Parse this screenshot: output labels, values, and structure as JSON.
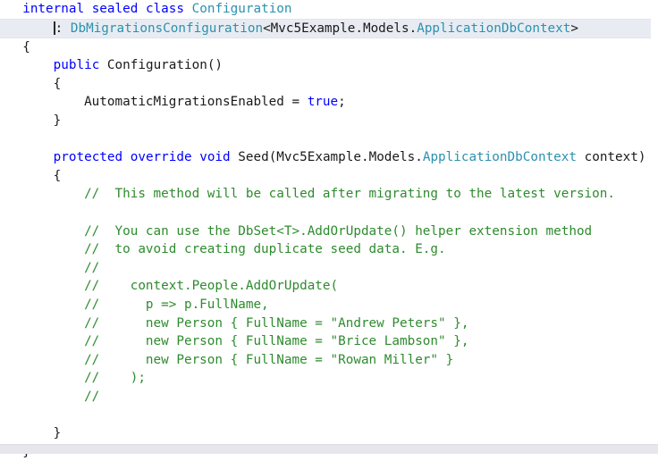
{
  "editor": {
    "language": "csharp",
    "colors": {
      "background": "#ffffff",
      "keyword": "#0000ff",
      "type": "#2b91af",
      "comment": "#2e8b2e",
      "plain": "#1a1a1a",
      "current_line_background": "#e8ecf2",
      "statusbar": "#e6e6ec"
    },
    "caret": {
      "line": 2,
      "column": 9
    },
    "lines": [
      {
        "n": 1,
        "current": false,
        "tokens": [
          {
            "t": "pln",
            "v": "  "
          },
          {
            "t": "kw",
            "v": "internal"
          },
          {
            "t": "pln",
            "v": " "
          },
          {
            "t": "kw",
            "v": "sealed"
          },
          {
            "t": "pln",
            "v": " "
          },
          {
            "t": "kw",
            "v": "class"
          },
          {
            "t": "pln",
            "v": " "
          },
          {
            "t": "type",
            "v": "Configuration"
          }
        ]
      },
      {
        "n": 2,
        "current": true,
        "caret_before": true,
        "tokens": [
          {
            "t": "pln",
            "v": "      "
          },
          {
            "t": "op",
            "v": ": "
          },
          {
            "t": "type",
            "v": "DbMigrationsConfiguration"
          },
          {
            "t": "op",
            "v": "<"
          },
          {
            "t": "pln",
            "v": "Mvc5Example.Models."
          },
          {
            "t": "type",
            "v": "ApplicationDbContext"
          },
          {
            "t": "op",
            "v": ">"
          }
        ]
      },
      {
        "n": 3,
        "current": false,
        "tokens": [
          {
            "t": "pln",
            "v": "  {"
          }
        ]
      },
      {
        "n": 4,
        "current": false,
        "tokens": [
          {
            "t": "pln",
            "v": "      "
          },
          {
            "t": "kw",
            "v": "public"
          },
          {
            "t": "pln",
            "v": " Configuration()"
          }
        ]
      },
      {
        "n": 5,
        "current": false,
        "tokens": [
          {
            "t": "pln",
            "v": "      {"
          }
        ]
      },
      {
        "n": 6,
        "current": false,
        "tokens": [
          {
            "t": "pln",
            "v": "          AutomaticMigrationsEnabled = "
          },
          {
            "t": "kw",
            "v": "true"
          },
          {
            "t": "pln",
            "v": ";"
          }
        ]
      },
      {
        "n": 7,
        "current": false,
        "tokens": [
          {
            "t": "pln",
            "v": "      }"
          }
        ]
      },
      {
        "n": 8,
        "current": false,
        "tokens": [
          {
            "t": "pln",
            "v": ""
          }
        ]
      },
      {
        "n": 9,
        "current": false,
        "tokens": [
          {
            "t": "pln",
            "v": "      "
          },
          {
            "t": "kw",
            "v": "protected"
          },
          {
            "t": "pln",
            "v": " "
          },
          {
            "t": "kw",
            "v": "override"
          },
          {
            "t": "pln",
            "v": " "
          },
          {
            "t": "kw",
            "v": "void"
          },
          {
            "t": "pln",
            "v": " Seed(Mvc5Example.Models."
          },
          {
            "t": "type",
            "v": "ApplicationDbContext"
          },
          {
            "t": "pln",
            "v": " context)"
          }
        ]
      },
      {
        "n": 10,
        "current": false,
        "tokens": [
          {
            "t": "pln",
            "v": "      {"
          }
        ]
      },
      {
        "n": 11,
        "current": false,
        "tokens": [
          {
            "t": "cmt",
            "v": "          //  This method will be called after migrating to the latest version."
          }
        ]
      },
      {
        "n": 12,
        "current": false,
        "tokens": [
          {
            "t": "pln",
            "v": ""
          }
        ]
      },
      {
        "n": 13,
        "current": false,
        "tokens": [
          {
            "t": "cmt",
            "v": "          //  You can use the DbSet<T>.AddOrUpdate() helper extension method"
          }
        ]
      },
      {
        "n": 14,
        "current": false,
        "tokens": [
          {
            "t": "cmt",
            "v": "          //  to avoid creating duplicate seed data. E.g."
          }
        ]
      },
      {
        "n": 15,
        "current": false,
        "tokens": [
          {
            "t": "cmt",
            "v": "          //"
          }
        ]
      },
      {
        "n": 16,
        "current": false,
        "tokens": [
          {
            "t": "cmt",
            "v": "          //    context.People.AddOrUpdate("
          }
        ]
      },
      {
        "n": 17,
        "current": false,
        "tokens": [
          {
            "t": "cmt",
            "v": "          //      p => p.FullName,"
          }
        ]
      },
      {
        "n": 18,
        "current": false,
        "tokens": [
          {
            "t": "cmt",
            "v": "          //      new Person { FullName = \"Andrew Peters\" },"
          }
        ]
      },
      {
        "n": 19,
        "current": false,
        "tokens": [
          {
            "t": "cmt",
            "v": "          //      new Person { FullName = \"Brice Lambson\" },"
          }
        ]
      },
      {
        "n": 20,
        "current": false,
        "tokens": [
          {
            "t": "cmt",
            "v": "          //      new Person { FullName = \"Rowan Miller\" }"
          }
        ]
      },
      {
        "n": 21,
        "current": false,
        "tokens": [
          {
            "t": "cmt",
            "v": "          //    );"
          }
        ]
      },
      {
        "n": 22,
        "current": false,
        "tokens": [
          {
            "t": "cmt",
            "v": "          //"
          }
        ]
      },
      {
        "n": 23,
        "current": false,
        "tokens": [
          {
            "t": "pln",
            "v": ""
          }
        ]
      },
      {
        "n": 24,
        "current": false,
        "tokens": [
          {
            "t": "pln",
            "v": "      }"
          }
        ]
      },
      {
        "n": 25,
        "current": false,
        "tokens": [
          {
            "t": "pln",
            "v": "  }"
          }
        ]
      }
    ]
  }
}
